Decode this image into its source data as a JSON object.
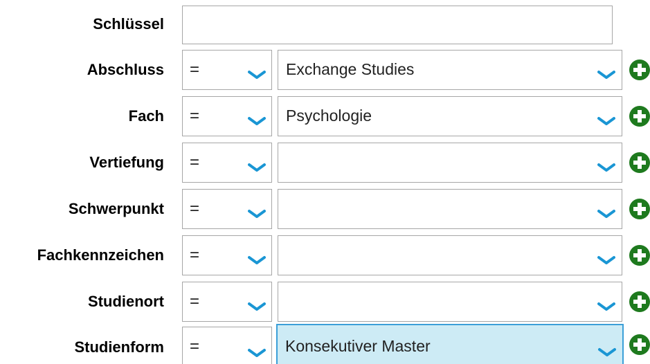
{
  "key_field": {
    "label": "Schlüssel",
    "value": ""
  },
  "rows": [
    {
      "label": "Abschluss",
      "operator": "=",
      "value": "Exchange Studies"
    },
    {
      "label": "Fach",
      "operator": "=",
      "value": "Psychologie"
    },
    {
      "label": "Vertiefung",
      "operator": "=",
      "value": ""
    },
    {
      "label": "Schwerpunkt",
      "operator": "=",
      "value": ""
    },
    {
      "label": "Fachkennzeichen",
      "operator": "=",
      "value": ""
    },
    {
      "label": "Studienort",
      "operator": "=",
      "value": ""
    },
    {
      "label": "Studienform",
      "operator": "=",
      "value": "Konsekutiver Master"
    }
  ],
  "colors": {
    "chevron": "#1a96d4",
    "add_button": "#1e7a1e",
    "highlight_bg": "#cdebf5",
    "highlight_border": "#3b9fd8"
  },
  "icons": {
    "dropdown": "chevron-down-icon",
    "add": "plus-circle-icon"
  }
}
